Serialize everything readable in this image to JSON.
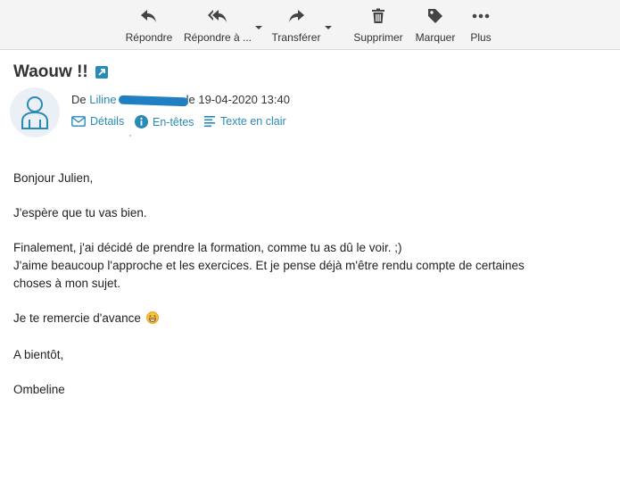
{
  "toolbar": {
    "reply": "Répondre",
    "reply_all": "Répondre à ...",
    "forward": "Transférer",
    "delete": "Supprimer",
    "mark": "Marquer",
    "more": "Plus"
  },
  "message": {
    "subject": "Waouw !!",
    "from_prefix": "De",
    "sender_name": "Liline",
    "date_text": "le 19-04-2020 13:40",
    "links": {
      "details": "Détails",
      "headers": "En-têtes",
      "plain": "Texte en clair"
    },
    "stray_mark": "'",
    "body": {
      "greeting": "Bonjour Julien,",
      "line1": "J'espère que tu vas bien.",
      "line2": "Finalement, j'ai décidé de prendre la formation, comme tu as dû le voir. ;)",
      "line3": "J'aime beaucoup l'approche et les exercices. Et je pense déjà m'être rendu compte de certaines",
      "line4": "choses à mon sujet.",
      "line5": "Je te remercie d'avance",
      "closing": "A bientôt,",
      "signature": "Ombeline"
    }
  },
  "colors": {
    "link": "#2a8ab7",
    "redaction": "#1f7fc2",
    "toolbar_bg": "#f4f4f4",
    "icon": "#444444"
  },
  "icons": [
    "reply-icon",
    "reply-all-icon",
    "forward-icon",
    "trash-icon",
    "tag-icon",
    "more-dots-icon",
    "external-link-icon",
    "avatar-icon",
    "envelope-icon",
    "info-icon",
    "plain-text-icon",
    "grin-emoji-icon"
  ]
}
